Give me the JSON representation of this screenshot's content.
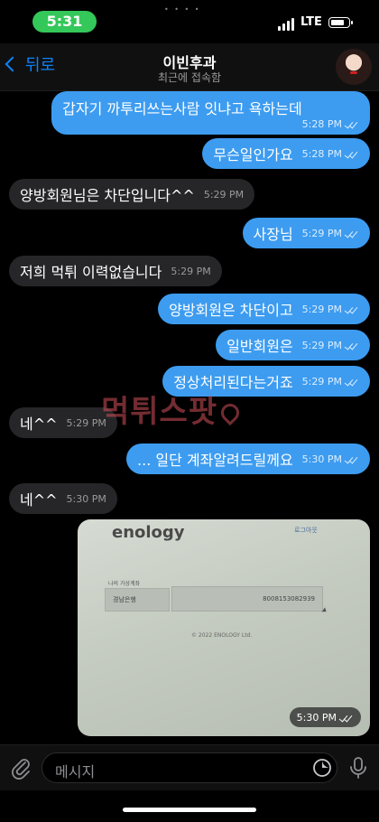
{
  "status_bar": {
    "time": "5:31",
    "network": "LTE",
    "battery_level": 0.8,
    "time_pill_color": "#34c759"
  },
  "header": {
    "back_label": "뒤로",
    "contact_name": "이빈후과",
    "contact_status": "최근에 접속함"
  },
  "messages": [
    {
      "dir": "out",
      "text": "갑자기 까투리쓰는사람 잇냐고 욕하는데",
      "time": "5:28 PM"
    },
    {
      "dir": "out",
      "text": "무슨일인가요",
      "time": "5:28 PM"
    },
    {
      "dir": "in",
      "text": "양방회원님은 차단입니다^^",
      "time": "5:29 PM"
    },
    {
      "dir": "out",
      "text": "사장님",
      "time": "5:29 PM"
    },
    {
      "dir": "in",
      "text": "저희 먹튀 이력없습니다",
      "time": "5:29 PM"
    },
    {
      "dir": "out",
      "text": "양방회원은 차단이고",
      "time": "5:29 PM"
    },
    {
      "dir": "out",
      "text": "일반회원은",
      "time": "5:29 PM"
    },
    {
      "dir": "out",
      "text": "정상처리된다는거죠",
      "time": "5:29 PM"
    },
    {
      "dir": "in",
      "text": "네^^",
      "time": "5:29 PM"
    },
    {
      "dir": "out",
      "text": "... 일단 계좌알려드릴께요",
      "time": "5:30 PM"
    },
    {
      "dir": "in",
      "text": "네^^",
      "time": "5:30 PM"
    }
  ],
  "watermark": "먹튀스팟",
  "photo": {
    "brand": "enology",
    "logout": "로그아웃",
    "section_label": "나의 가상계좌",
    "bank": "경남은행",
    "account_number": "8008153082939",
    "copyright": "© 2022 ENOLOGY Ltd.",
    "time": "5:30 PM"
  },
  "composer": {
    "placeholder": "메시지"
  },
  "colors": {
    "outgoing": "#3d9cf0",
    "incoming": "#262628",
    "accent": "#0a84ff"
  }
}
